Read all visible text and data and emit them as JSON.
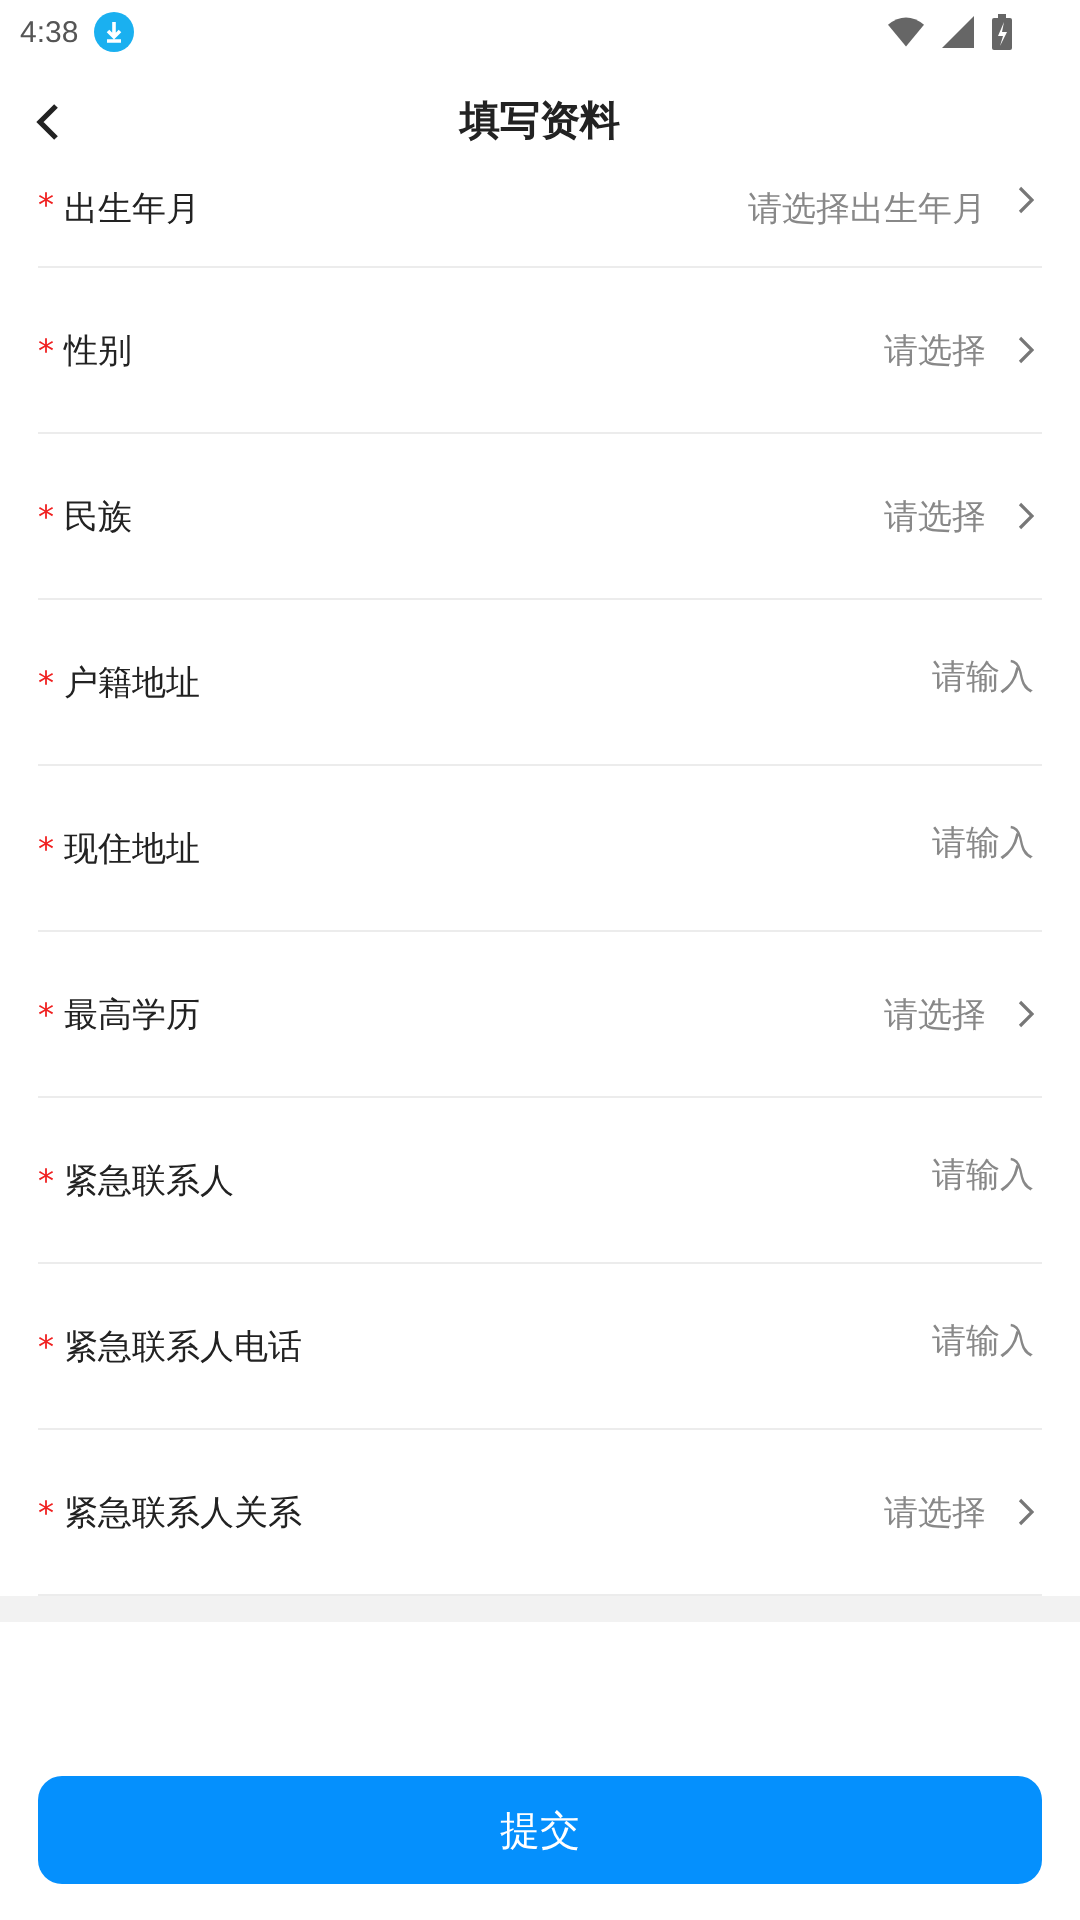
{
  "status_bar": {
    "time": "4:38"
  },
  "header": {
    "title": "填写资料"
  },
  "fields": [
    {
      "label": "出生年月",
      "required_mark": "*",
      "kind": "select",
      "placeholder": "请选择出生年月"
    },
    {
      "label": "性别",
      "required_mark": "*",
      "kind": "select",
      "placeholder": "请选择"
    },
    {
      "label": "民族",
      "required_mark": "*",
      "kind": "select",
      "placeholder": "请选择"
    },
    {
      "label": "户籍地址",
      "required_mark": "*",
      "kind": "input",
      "placeholder": "请输入"
    },
    {
      "label": "现住地址",
      "required_mark": "*",
      "kind": "input",
      "placeholder": "请输入"
    },
    {
      "label": "最高学历",
      "required_mark": "*",
      "kind": "select",
      "placeholder": "请选择"
    },
    {
      "label": "紧急联系人",
      "required_mark": "*",
      "kind": "input",
      "placeholder": "请输入"
    },
    {
      "label": "紧急联系人电话",
      "required_mark": "*",
      "kind": "input",
      "placeholder": "请输入"
    },
    {
      "label": "紧急联系人关系",
      "required_mark": "*",
      "kind": "select",
      "placeholder": "请选择"
    }
  ],
  "submit": {
    "label": "提交"
  }
}
